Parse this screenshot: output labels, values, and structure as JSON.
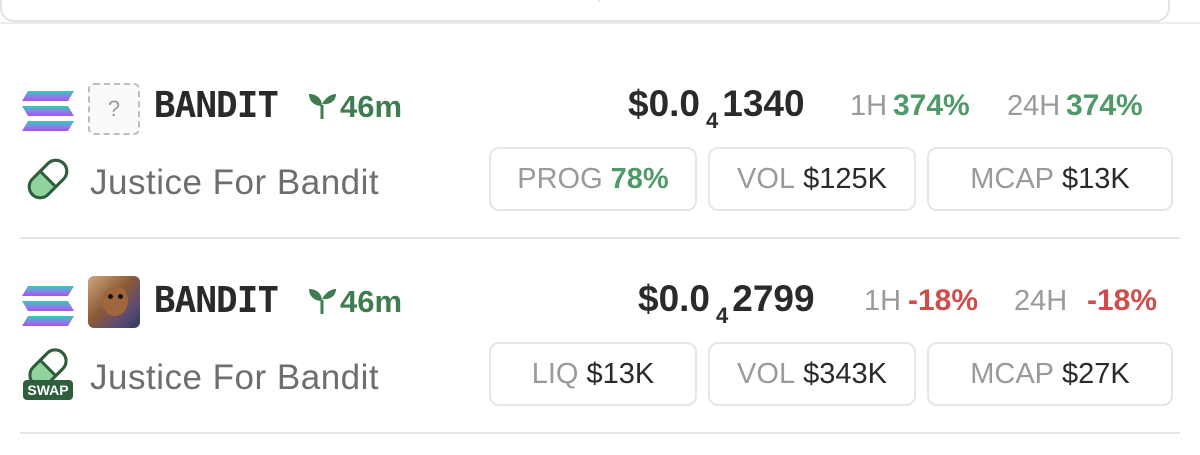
{
  "tokens": [
    {
      "ticker": "BANDIT",
      "age": "46m",
      "name": "Justice For Bandit",
      "image_placeholder": "?",
      "price_prefix": "$0.0",
      "price_zeros": "4",
      "price_digits": "1340",
      "tf1_label": "1H",
      "tf1_value": "374%",
      "tf2_label": "24H",
      "tf2_value": "374%",
      "change_color": "#4f9a68",
      "stats": [
        {
          "label": "PROG",
          "value": "78%"
        },
        {
          "label": "VOL",
          "value": "$125K"
        },
        {
          "label": "MCAP",
          "value": "$13K"
        }
      ],
      "platform_icon": "pill-icon"
    },
    {
      "ticker": "BANDIT",
      "age": "46m",
      "name": "Justice For Bandit",
      "price_prefix": "$0.0",
      "price_zeros": "4",
      "price_digits": "2799",
      "tf1_label": "1H",
      "tf1_value": "-18%",
      "tf2_label": "24H",
      "tf2_value": "-18%",
      "change_color": "#d24c4c",
      "stats": [
        {
          "label": "LIQ",
          "value": "$13K"
        },
        {
          "label": "VOL",
          "value": "$343K"
        },
        {
          "label": "MCAP",
          "value": "$27K"
        }
      ],
      "platform_icon": "pill-swap-icon",
      "platform_badge": "SWAP"
    }
  ],
  "icons": {
    "chain": "solana-icon",
    "age": "sprout-icon"
  },
  "colors": {
    "positive": "#4f9a68",
    "negative": "#d24c4c",
    "age_green": "#3f7d50"
  }
}
